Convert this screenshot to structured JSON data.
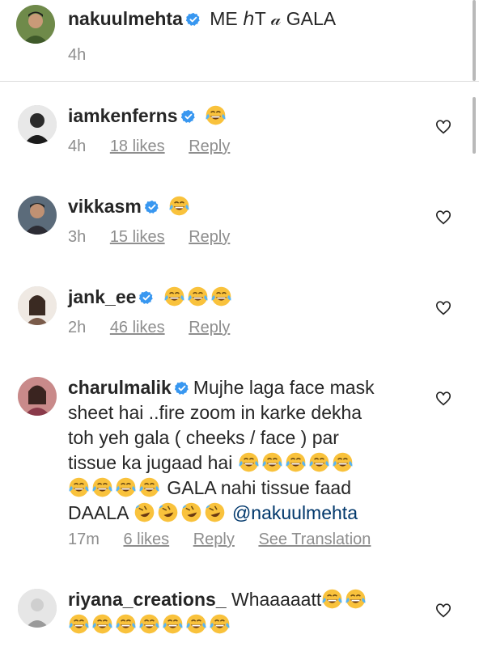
{
  "caption": {
    "username": "nakuulmehta",
    "text": "ME ℎT 𝒶 GALA",
    "time": "4h"
  },
  "comments": [
    {
      "username": "iamkenferns",
      "text": "",
      "emoji_count": 1,
      "emoji": "face-with-tears-of-joy",
      "time": "4h",
      "likes": "18 likes",
      "reply": "Reply"
    },
    {
      "username": "vikkasm",
      "text": "",
      "emoji_count": 1,
      "emoji": "face-with-tears-of-joy",
      "time": "3h",
      "likes": "15 likes",
      "reply": "Reply"
    },
    {
      "username": "jank_ee",
      "text": "",
      "emoji_count": 3,
      "emoji": "face-with-tears-of-joy",
      "time": "2h",
      "likes": "46 likes",
      "reply": "Reply"
    },
    {
      "username": "charulmalik",
      "line1": "Mujhe laga face mask",
      "line2": "sheet hai ..fire zoom in karke dekha",
      "line3": "toh yeh gala ( cheeks / face ) par",
      "line4": "tissue ka jugaad hai",
      "line5": "GALA nahi tissue faad",
      "line6": "DAALA",
      "mention": "@nakuulmehta",
      "time": "17m",
      "likes": "6 likes",
      "reply": "Reply",
      "see_translation": "See Translation"
    },
    {
      "username": "riyana_creations_",
      "text": "Whaaaaatt",
      "emoji_count": 9,
      "emoji": "face-with-tears-of-joy"
    }
  ],
  "colors": {
    "text": "#262626",
    "muted": "#8e8e8e",
    "verified": "#3897f0",
    "mention": "#00376b",
    "emoji": "#f9c23c"
  }
}
